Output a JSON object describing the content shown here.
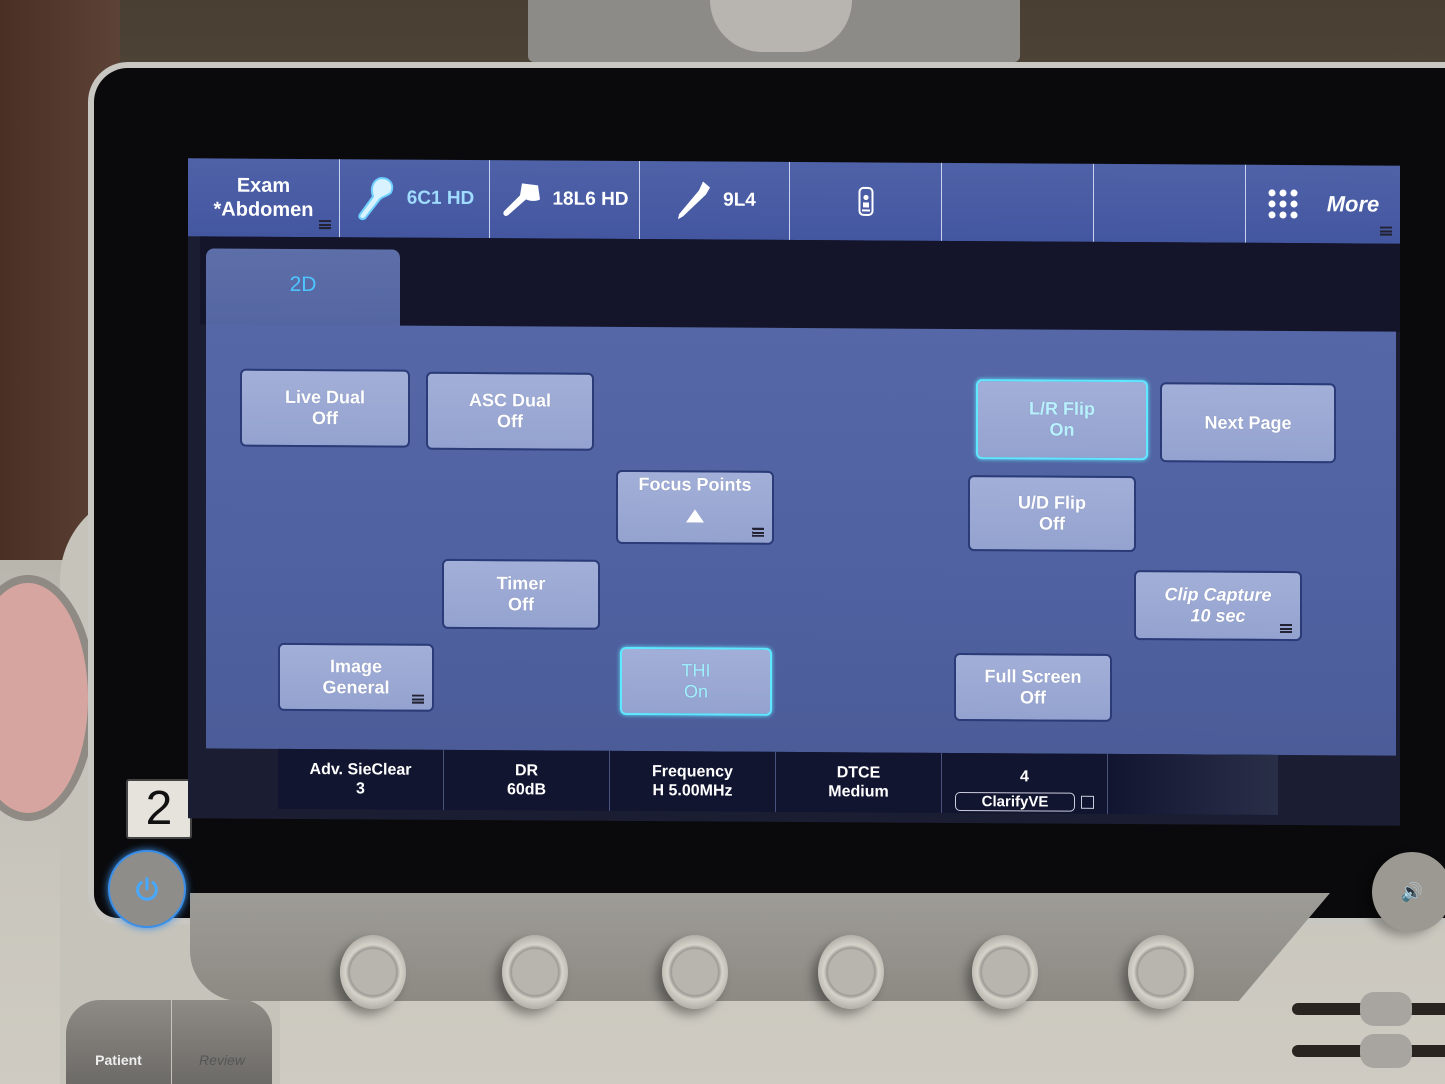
{
  "topbar": {
    "exam": {
      "line1": "Exam",
      "line2": "*Abdomen"
    },
    "probes": [
      {
        "label": "6C1 HD",
        "icon": "curved-probe-icon",
        "active": true
      },
      {
        "label": "18L6 HD",
        "icon": "linear-probe-icon",
        "active": false
      },
      {
        "label": "9L4",
        "icon": "pencil-probe-icon",
        "active": false
      }
    ],
    "status_icon": "remote-device-icon",
    "more": {
      "label": "More",
      "icon": "grid-dots-icon"
    }
  },
  "tabs": [
    {
      "label": "2D",
      "active": true
    }
  ],
  "buttons": {
    "live_dual": {
      "title": "Live Dual",
      "value": "Off"
    },
    "asc_dual": {
      "title": "ASC Dual",
      "value": "Off"
    },
    "focus_points": {
      "title": "Focus Points",
      "value": "▲"
    },
    "timer": {
      "title": "Timer",
      "value": "Off"
    },
    "image": {
      "title": "Image",
      "value": "General"
    },
    "thi": {
      "title": "THI",
      "value": "On"
    },
    "lr_flip": {
      "title": "L/R Flip",
      "value": "On"
    },
    "next_page": {
      "title": "Next Page"
    },
    "ud_flip": {
      "title": "U/D Flip",
      "value": "Off"
    },
    "clip_capture": {
      "title": "Clip Capture",
      "value": "10 sec"
    },
    "full_screen": {
      "title": "Full Screen",
      "value": "Off"
    }
  },
  "bottombar": [
    {
      "title": "Adv. SieClear",
      "value": "3"
    },
    {
      "title": "DR",
      "value": "60dB"
    },
    {
      "title": "Frequency",
      "value": "H 5.00MHz"
    },
    {
      "title": "DTCE",
      "value": "Medium"
    },
    {
      "title": "4",
      "value": "ClarifyVE"
    }
  ],
  "hardware": {
    "monitor_number": "2",
    "key_patient": "Patient",
    "key_review": "Review"
  },
  "colors": {
    "accent_active": "#5fe8ff",
    "panel_blue": "#4f61a0",
    "button_fill": "#9aa8d4"
  }
}
